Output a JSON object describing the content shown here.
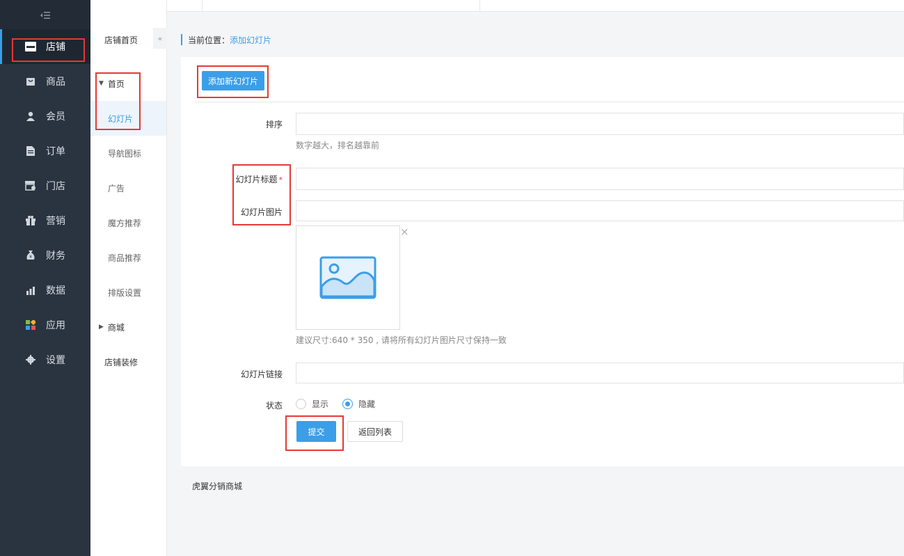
{
  "sidebar": {
    "toggle_icon": "collapse-menu-icon",
    "items": [
      {
        "label": "店铺",
        "icon": "store-icon",
        "active": true
      },
      {
        "label": "商品",
        "icon": "bag-icon"
      },
      {
        "label": "会员",
        "icon": "user-icon"
      },
      {
        "label": "订单",
        "icon": "document-icon"
      },
      {
        "label": "门店",
        "icon": "shop-icon"
      },
      {
        "label": "营销",
        "icon": "gift-icon"
      },
      {
        "label": "财务",
        "icon": "money-bag-icon"
      },
      {
        "label": "数据",
        "icon": "bar-chart-icon"
      },
      {
        "label": "应用",
        "icon": "apps-icon"
      },
      {
        "label": "设置",
        "icon": "gear-icon"
      }
    ]
  },
  "submenu": {
    "title": "店铺首页",
    "items": [
      {
        "label": "首页",
        "type": "group"
      },
      {
        "label": "幻灯片",
        "active": true
      },
      {
        "label": "导航图标"
      },
      {
        "label": "广告"
      },
      {
        "label": "魔方推荐"
      },
      {
        "label": "商品推荐"
      },
      {
        "label": "排版设置"
      },
      {
        "label": "商城",
        "type": "group"
      },
      {
        "label": "店铺装修",
        "type": "plain"
      }
    ]
  },
  "breadcrumb": {
    "prefix": "当前位置：",
    "current": "添加幻灯片"
  },
  "form": {
    "add_button": "添加新幻灯片",
    "sort_label": "排序",
    "sort_help": "数字越大，排名越靠前",
    "title_label": "幻灯片标题",
    "required_mark": "*",
    "image_label": "幻灯片图片",
    "image_help": "建议尺寸:640 * 350 , 请将所有幻灯片图片尺寸保持一致",
    "image_close": "×",
    "link_label": "幻灯片链接",
    "status_label": "状态",
    "status_options": [
      {
        "label": "显示",
        "checked": false
      },
      {
        "label": "隐藏",
        "checked": true
      }
    ],
    "submit_button": "提交",
    "back_button": "返回列表"
  },
  "footer": {
    "text": "虎翼分销商城"
  },
  "colors": {
    "accent": "#3b9ee8",
    "sidebar_bg": "#2a3440",
    "highlight_box": "#e53935"
  }
}
